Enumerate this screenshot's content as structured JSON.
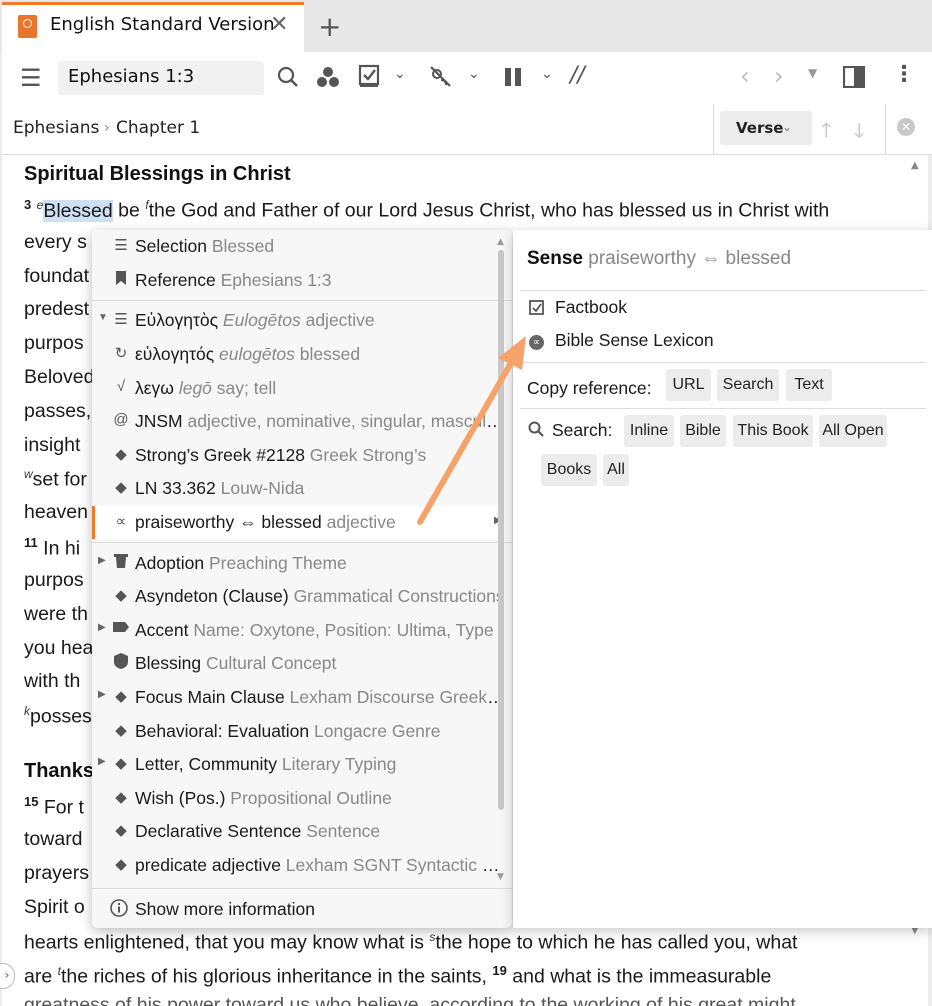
{
  "tab": {
    "title": "English Standard Version"
  },
  "toolbar": {
    "reference": "Ephesians 1:3"
  },
  "breadcrumb": {
    "book": "Ephesians",
    "separator": "›",
    "chapter": "Chapter 1"
  },
  "nav": {
    "verse_label": "Verse"
  },
  "reader": {
    "heading1": "Spiritual Blessings in Christ",
    "v3_num": "3",
    "v3_sup_e": "e",
    "v3_word": "Blessed",
    "v3_be": " be ",
    "v3_sup_f": "f",
    "v3_rest": "the God and Father of our Lord Jesus Christ, who has blessed us in Christ with",
    "l2": "every s",
    "l3": "foundat",
    "l4": "predest",
    "l5": "purpos",
    "l6": "Beloved",
    "l7": "passes,",
    "l8": "insight",
    "l9_sup": "w",
    "l9": "set for",
    "l10": "heaven",
    "l11_num": "11",
    "l11": "In hi",
    "l12": "purpos",
    "l13": "were th",
    "l14": "you hea",
    "l15": "with th",
    "l16_sup": "k",
    "l16": "posses",
    "heading2": "Thanks",
    "l17_num": "15",
    "l17": "For t",
    "l18": "toward",
    "l19": "prayers",
    "l20": "Spirit o",
    "l21a": "hearts enlightened, that you may know what is ",
    "l21_sup": "s",
    "l21b": "the hope to which he has called you, what",
    "l22a": "are ",
    "l22_sup": "t",
    "l22b": "the riches of his glorious inheritance in the saints, ",
    "l22_num": "19",
    "l22c": "and what is the immeasurable",
    "l23": "greatness of his power toward us who believe, according to the working of his great might"
  },
  "menu": {
    "rows": [
      {
        "icon": "lines-icon",
        "label": "Selection",
        "sub": " Blessed"
      },
      {
        "icon": "bookmark-icon",
        "label": "Reference",
        "sub": " Ephesians 1:3"
      },
      {
        "icon": "lines-icon",
        "label": "Εὐλογητὸς",
        "sub_italic": " Eulogētos",
        "sub": " adjective"
      },
      {
        "icon": "refresh-icon",
        "label": "εὐλογητός",
        "sub_italic": " eulogētos",
        "sub": " blessed"
      },
      {
        "icon": "root-icon",
        "label": "λεγω",
        "sub_italic": " legō",
        "sub": " say; tell"
      },
      {
        "icon": "at-icon",
        "label": "JNSM",
        "sub": " adjective, nominative, singular, masculine"
      },
      {
        "icon": "diamond-icon",
        "label": "Strong’s Greek #2128",
        "sub": " Greek Strong’s"
      },
      {
        "icon": "diamond-icon",
        "label": "LN 33.362",
        "sub": " Louw-Nida"
      },
      {
        "icon": "sense-icon",
        "label": "praiseworthy ⇔ blessed",
        "sub": " adjective"
      },
      {
        "icon": "trash-icon",
        "label": "Adoption",
        "sub": " Preaching Theme"
      },
      {
        "icon": "diamond-icon",
        "label": "Asyndeton (Clause)",
        "sub": " Grammatical Constructions"
      },
      {
        "icon": "tag-icon",
        "label": "Accent",
        "sub": " Name: Oxytone, Position: Ultima, Type"
      },
      {
        "icon": "shield-icon",
        "label": "Blessing",
        "sub": " Cultural Concept"
      },
      {
        "icon": "diamond-icon",
        "label": "Focus Main Clause",
        "sub": " Lexham Discourse Greek NT"
      },
      {
        "icon": "diamond-icon",
        "label": "Behavioral: Evaluation",
        "sub": " Longacre Genre"
      },
      {
        "icon": "diamond-icon",
        "label": "Letter, Community",
        "sub": " Literary Typing"
      },
      {
        "icon": "diamond-icon",
        "label": "Wish (Pos.)",
        "sub": " Propositional Outline"
      },
      {
        "icon": "diamond-icon",
        "label": "Declarative Sentence",
        "sub": " Sentence"
      },
      {
        "icon": "diamond-icon",
        "label": "predicate adjective",
        "sub": " Lexham SGNT Syntactic Force"
      }
    ],
    "footer": "Show more information"
  },
  "panel": {
    "title": "Sense",
    "subtitle": " praiseworthy ⇔ blessed",
    "links": [
      "Factbook",
      "Bible Sense Lexicon"
    ],
    "copy_label": "Copy reference:",
    "copy_buttons": [
      "URL",
      "Search",
      "Text"
    ],
    "search_label": "Search:",
    "search_buttons": [
      "Inline",
      "Bible",
      "This Book",
      "All Open",
      "Books",
      "All"
    ]
  },
  "colors": {
    "accent": "#f07a2a",
    "arrow": "#f7a26a",
    "highlight": "#cfe0f3"
  }
}
